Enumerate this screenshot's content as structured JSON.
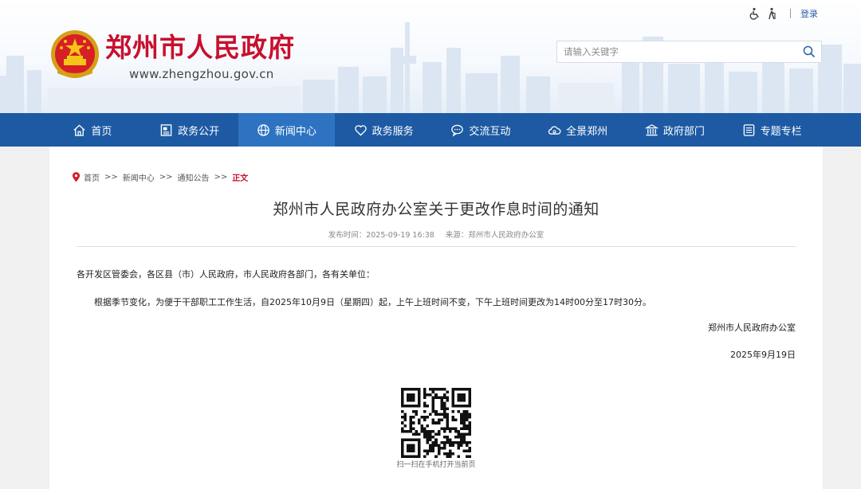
{
  "header": {
    "site_title": "郑州市人民政府",
    "site_url": "www.zhengzhou.gov.cn",
    "login_label": "登录",
    "search_placeholder": "请输入关键字"
  },
  "nav": {
    "items": [
      {
        "label": "首页",
        "icon": "home-icon"
      },
      {
        "label": "政务公开",
        "icon": "document-icon"
      },
      {
        "label": "新闻中心",
        "icon": "globe-icon",
        "active": true
      },
      {
        "label": "政务服务",
        "icon": "heart-icon"
      },
      {
        "label": "交流互动",
        "icon": "chat-icon"
      },
      {
        "label": "全景郑州",
        "icon": "cloud-icon"
      },
      {
        "label": "政府部门",
        "icon": "building-icon"
      },
      {
        "label": "专题专栏",
        "icon": "list-icon"
      }
    ]
  },
  "breadcrumb": {
    "items": [
      "首页",
      "新闻中心",
      "通知公告"
    ],
    "separator": ">>",
    "current": "正文"
  },
  "article": {
    "title": "郑州市人民政府办公室关于更改作息时间的通知",
    "publish_time": "发布时间：2025-09-19 16:38",
    "source": "来源：郑州市人民政府办公室",
    "salutation": "各开发区管委会，各区县（市）人民政府，市人民政府各部门，各有关单位：",
    "body": "根据季节变化，为便于干部职工工作生活，自2025年10月9日（星期四）起，上午上班时间不变，下午上班时间更改为14时00分至17时30分。",
    "signature": "郑州市人民政府办公室",
    "date": "2025年9月19日"
  },
  "qr": {
    "caption": "扫一扫在手机打开当前页"
  },
  "colors": {
    "brand_red": "#c8102e",
    "nav_blue": "#1d5aa3",
    "nav_active": "#2e73c2"
  }
}
